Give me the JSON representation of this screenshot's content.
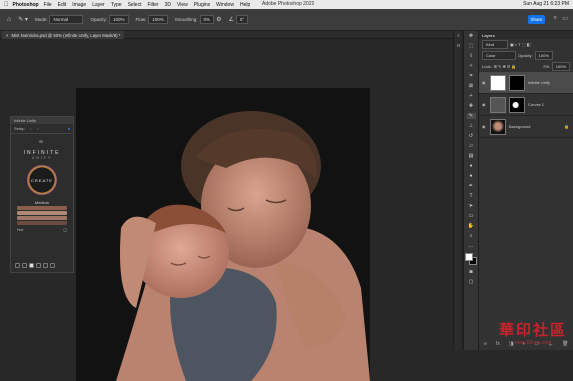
{
  "menubar": {
    "app": "Photoshop",
    "items": [
      "File",
      "Edit",
      "Image",
      "Layer",
      "Type",
      "Select",
      "Filter",
      "3D",
      "View",
      "Plugins",
      "Window",
      "Help"
    ],
    "window_title": "Adobe Photoshop 2022",
    "datetime": "Sun Aug 21 6:23 PM"
  },
  "options": {
    "mode_label": "Mode:",
    "mode_value": "Normal",
    "opacity_label": "Opacity:",
    "opacity_value": "100%",
    "flow_label": "Flow:",
    "flow_value": "100%",
    "smoothing_label": "Smoothing:",
    "smoothing_value": "0%",
    "angle_value": "0°",
    "share": "Share"
  },
  "document": {
    "tab_label": "Mist NoInricks.psd @ 50% (Infinite Unify, Layer Mask/8) *"
  },
  "unify": {
    "panel_title": "Infinite Unify",
    "tab_setup": "Setup",
    "brand": "INFINITE",
    "brand_sub": "UNIFY",
    "create_label": "CREATE",
    "medium_label": "Medium",
    "hue_label": "Hue",
    "swatches": [
      "#8c5e4e",
      "#b08877",
      "#a07666",
      "#6c4b42"
    ]
  },
  "layers": {
    "title": "Layers",
    "kind": "Kind",
    "blend": "Color",
    "opacity_label": "Opacity:",
    "opacity_value": "100%",
    "lock_label": "Lock:",
    "fill_label": "Fill:",
    "fill_value": "100%",
    "items": [
      {
        "name": "Infinite Unify"
      },
      {
        "name": "Curves 1"
      },
      {
        "name": "Background"
      }
    ]
  },
  "watermark": {
    "text": "華印社區",
    "url": "www.52cnp.com"
  }
}
